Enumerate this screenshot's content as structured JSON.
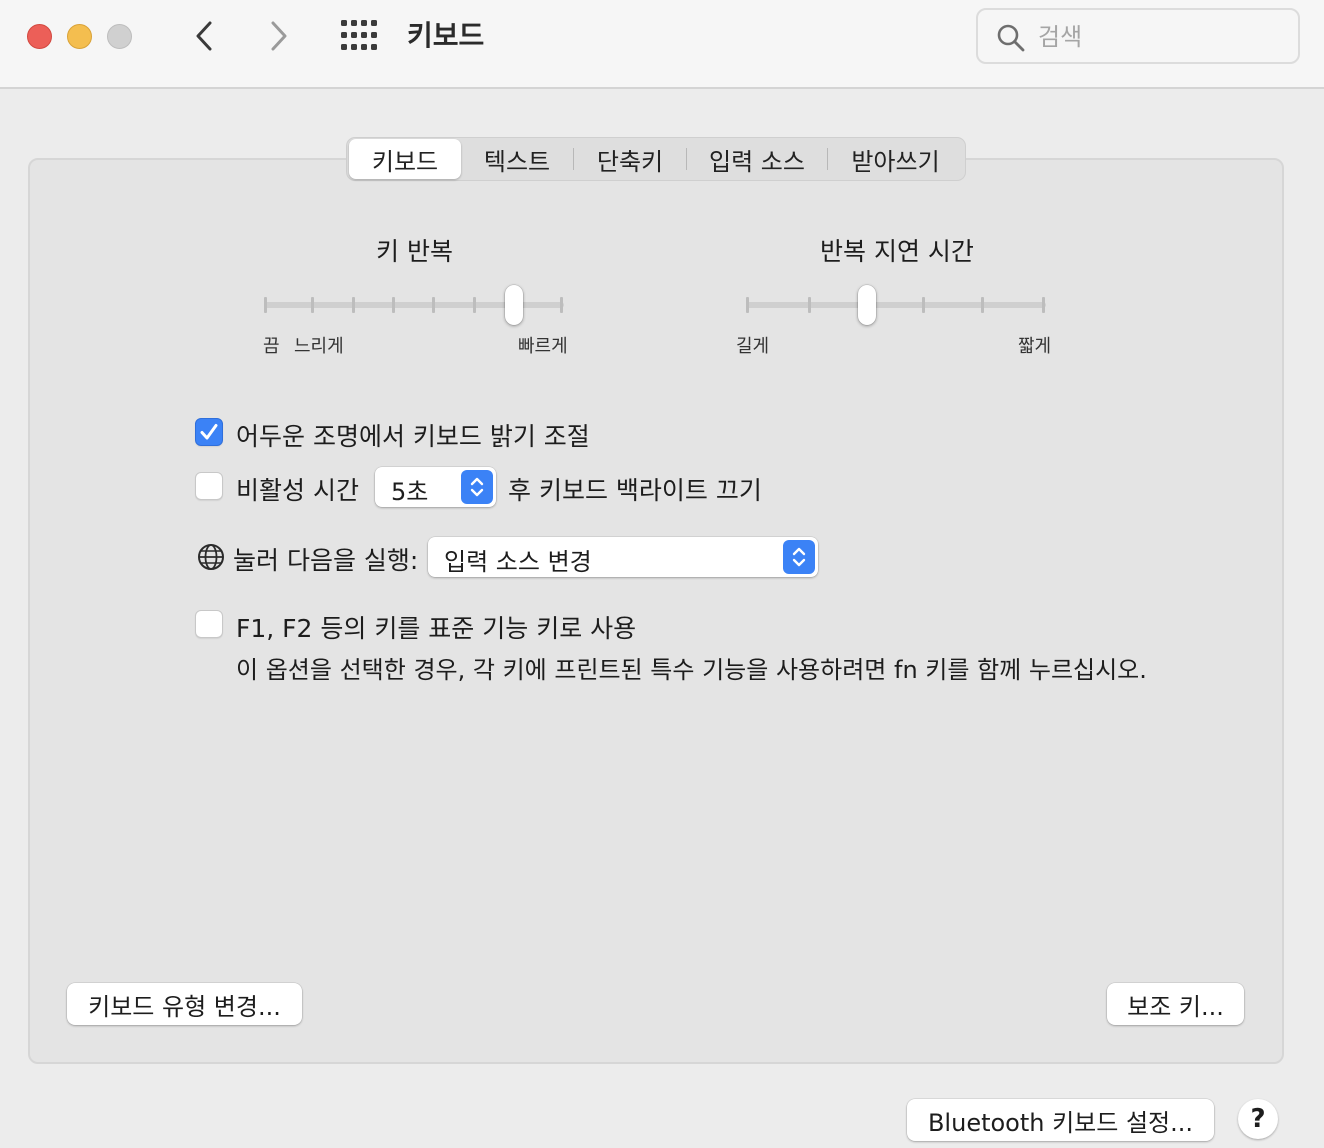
{
  "window": {
    "title": "키보드",
    "search_placeholder": "검색"
  },
  "tabs": [
    {
      "label": "키보드",
      "active": true
    },
    {
      "label": "텍스트",
      "active": false
    },
    {
      "label": "단축키",
      "active": false
    },
    {
      "label": "입력 소스",
      "active": false
    },
    {
      "label": "받아쓰기",
      "active": false
    }
  ],
  "key_repeat": {
    "title": "키 반복",
    "label_off": "끔",
    "label_slow": "느리게",
    "label_fast": "빠르게",
    "tick_count": 8,
    "selected_index": 6
  },
  "repeat_delay": {
    "title": "반복 지연 시간",
    "label_long": "길게",
    "label_short": "짧게",
    "tick_count": 6,
    "selected_index": 2
  },
  "options": {
    "adjust_brightness": {
      "label": "어두운 조명에서 키보드 밝기 조절",
      "checked": true
    },
    "backlight_off": {
      "checked": false,
      "label_before": "비활성 시간",
      "value": "5초",
      "label_after": "후 키보드 백라이트 끄기"
    },
    "globe_key": {
      "label": "눌러 다음을 실행:",
      "value": "입력 소스 변경"
    },
    "fn_keys": {
      "checked": false,
      "label": "F1, F2 등의 키를 표준 기능 키로 사용",
      "description": "이 옵션을 선택한 경우, 각 키에 프린트된 특수 기능을 사용하려면 fn 키를 함께 누르십시오."
    }
  },
  "buttons": {
    "change_keyboard_type": "키보드 유형 변경...",
    "modifier_keys": "보조 키...",
    "bluetooth_setup": "Bluetooth 키보드 설정...",
    "help": "?"
  },
  "colors": {
    "accent": "#3b82f6",
    "close": "#ec5f58",
    "minimize": "#f4be4f",
    "zoom_disabled": "#d0d0d0"
  }
}
